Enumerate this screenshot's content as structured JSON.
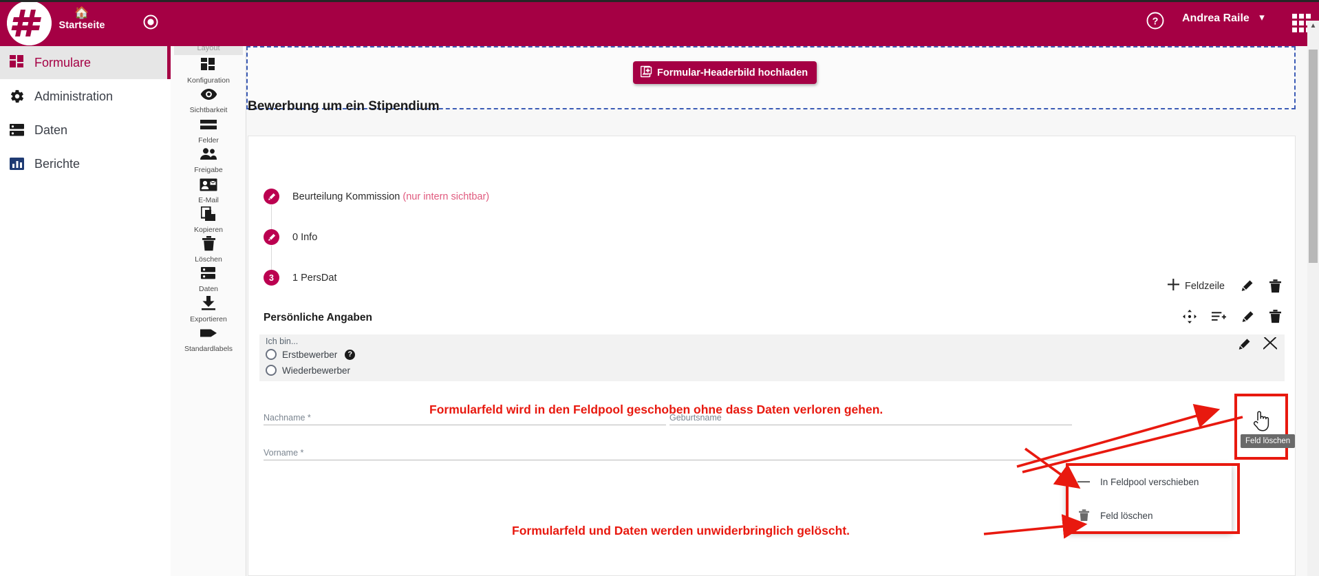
{
  "topbar": {
    "logo_name": "hash-logo",
    "home_label": "Startseite",
    "home_icon": "home-icon",
    "record_icon": "record-circle-icon",
    "help_icon": "question-circle-icon",
    "user_name": "Andrea Raile",
    "user_chevron": "⌄",
    "apps_icon": "apps-grid-icon",
    "bg_color": "#a50044"
  },
  "sidebar": {
    "items": [
      {
        "label": "Formulare",
        "icon": "grid-squares-icon",
        "active": true
      },
      {
        "label": "Administration",
        "icon": "gear-icon",
        "active": false
      },
      {
        "label": "Daten",
        "icon": "database-icon",
        "active": false
      },
      {
        "label": "Berichte",
        "icon": "bar-chart-icon",
        "active": false
      }
    ]
  },
  "iconrail": {
    "tab_label": "Layout",
    "items": [
      {
        "label": "Konfiguration",
        "icon": "grid-squares-icon"
      },
      {
        "label": "Sichtbarkeit",
        "icon": "eye-icon"
      },
      {
        "label": "Felder",
        "icon": "rows-icon"
      },
      {
        "label": "Freigabe",
        "icon": "people-icon"
      },
      {
        "label": "E-Mail",
        "icon": "contact-card-icon"
      },
      {
        "label": "Kopieren",
        "icon": "copy-icon"
      },
      {
        "label": "Löschen",
        "icon": "trash-icon"
      },
      {
        "label": "Daten",
        "icon": "database-icon"
      },
      {
        "label": "Exportieren",
        "icon": "download-icon"
      },
      {
        "label": "Standardlabels",
        "icon": "tag-icon"
      }
    ]
  },
  "main": {
    "upload_button": "Formular-Headerbild hochladen",
    "upload_icon": "image-add-icon",
    "form_title": "Bewerbung um ein Stipendium",
    "sections": [
      {
        "badge": "✎",
        "badge_type": "pencil",
        "label": "Beurteilung Kommission",
        "note": "(nur intern sichtbar)"
      },
      {
        "badge": "✎",
        "badge_type": "pencil",
        "label": "0 Info",
        "note": ""
      },
      {
        "badge": "3",
        "badge_type": "number",
        "label": "1 PersDat",
        "note": ""
      }
    ],
    "row_toolbar": {
      "add_label": "Feldzeile",
      "add_icon": "plus-icon",
      "edit_icon": "pencil-icon",
      "delete_icon": "trash-icon"
    },
    "group": {
      "title": "Persönliche Angaben",
      "tools": [
        {
          "icon": "move-arrows-icon"
        },
        {
          "icon": "add-row-icon"
        },
        {
          "icon": "pencil-icon"
        },
        {
          "icon": "trash-icon"
        }
      ]
    },
    "field_block": {
      "label": "Ich bin...",
      "options": [
        {
          "label": "Erstbewerber",
          "has_help": true,
          "help_icon": "question-mark-icon"
        },
        {
          "label": "Wiederbewerber",
          "has_help": false,
          "help_icon": ""
        }
      ],
      "tools": [
        {
          "icon": "pencil-icon"
        },
        {
          "icon": "close-x-icon"
        }
      ]
    },
    "inputs": [
      {
        "label": "Nachname *",
        "value": "",
        "placeholder": "Nachname *"
      },
      {
        "label": "Geburtsname",
        "value": "",
        "placeholder": "Geburtsname"
      },
      {
        "label": "Vorname *",
        "value": "",
        "placeholder": "Vorname *"
      }
    ]
  },
  "context_menu": {
    "items": [
      {
        "label": "In Feldpool verschieben",
        "icon": "minus-icon"
      },
      {
        "label": "Feld löschen",
        "icon": "trash-icon"
      }
    ]
  },
  "tooltip": {
    "text": "Feld löschen"
  },
  "annotations": {
    "line1": "Formularfeld wird in den Feldpool geschoben ohne dass Daten verloren gehen.",
    "line2": "Formularfeld und Daten werden unwiderbringlich gelöscht.",
    "color": "#e8190f"
  },
  "colors": {
    "brand": "#a50044",
    "accent": "#bb0050",
    "annotation": "#e8190f",
    "dashed_border": "#3b5bb5"
  }
}
